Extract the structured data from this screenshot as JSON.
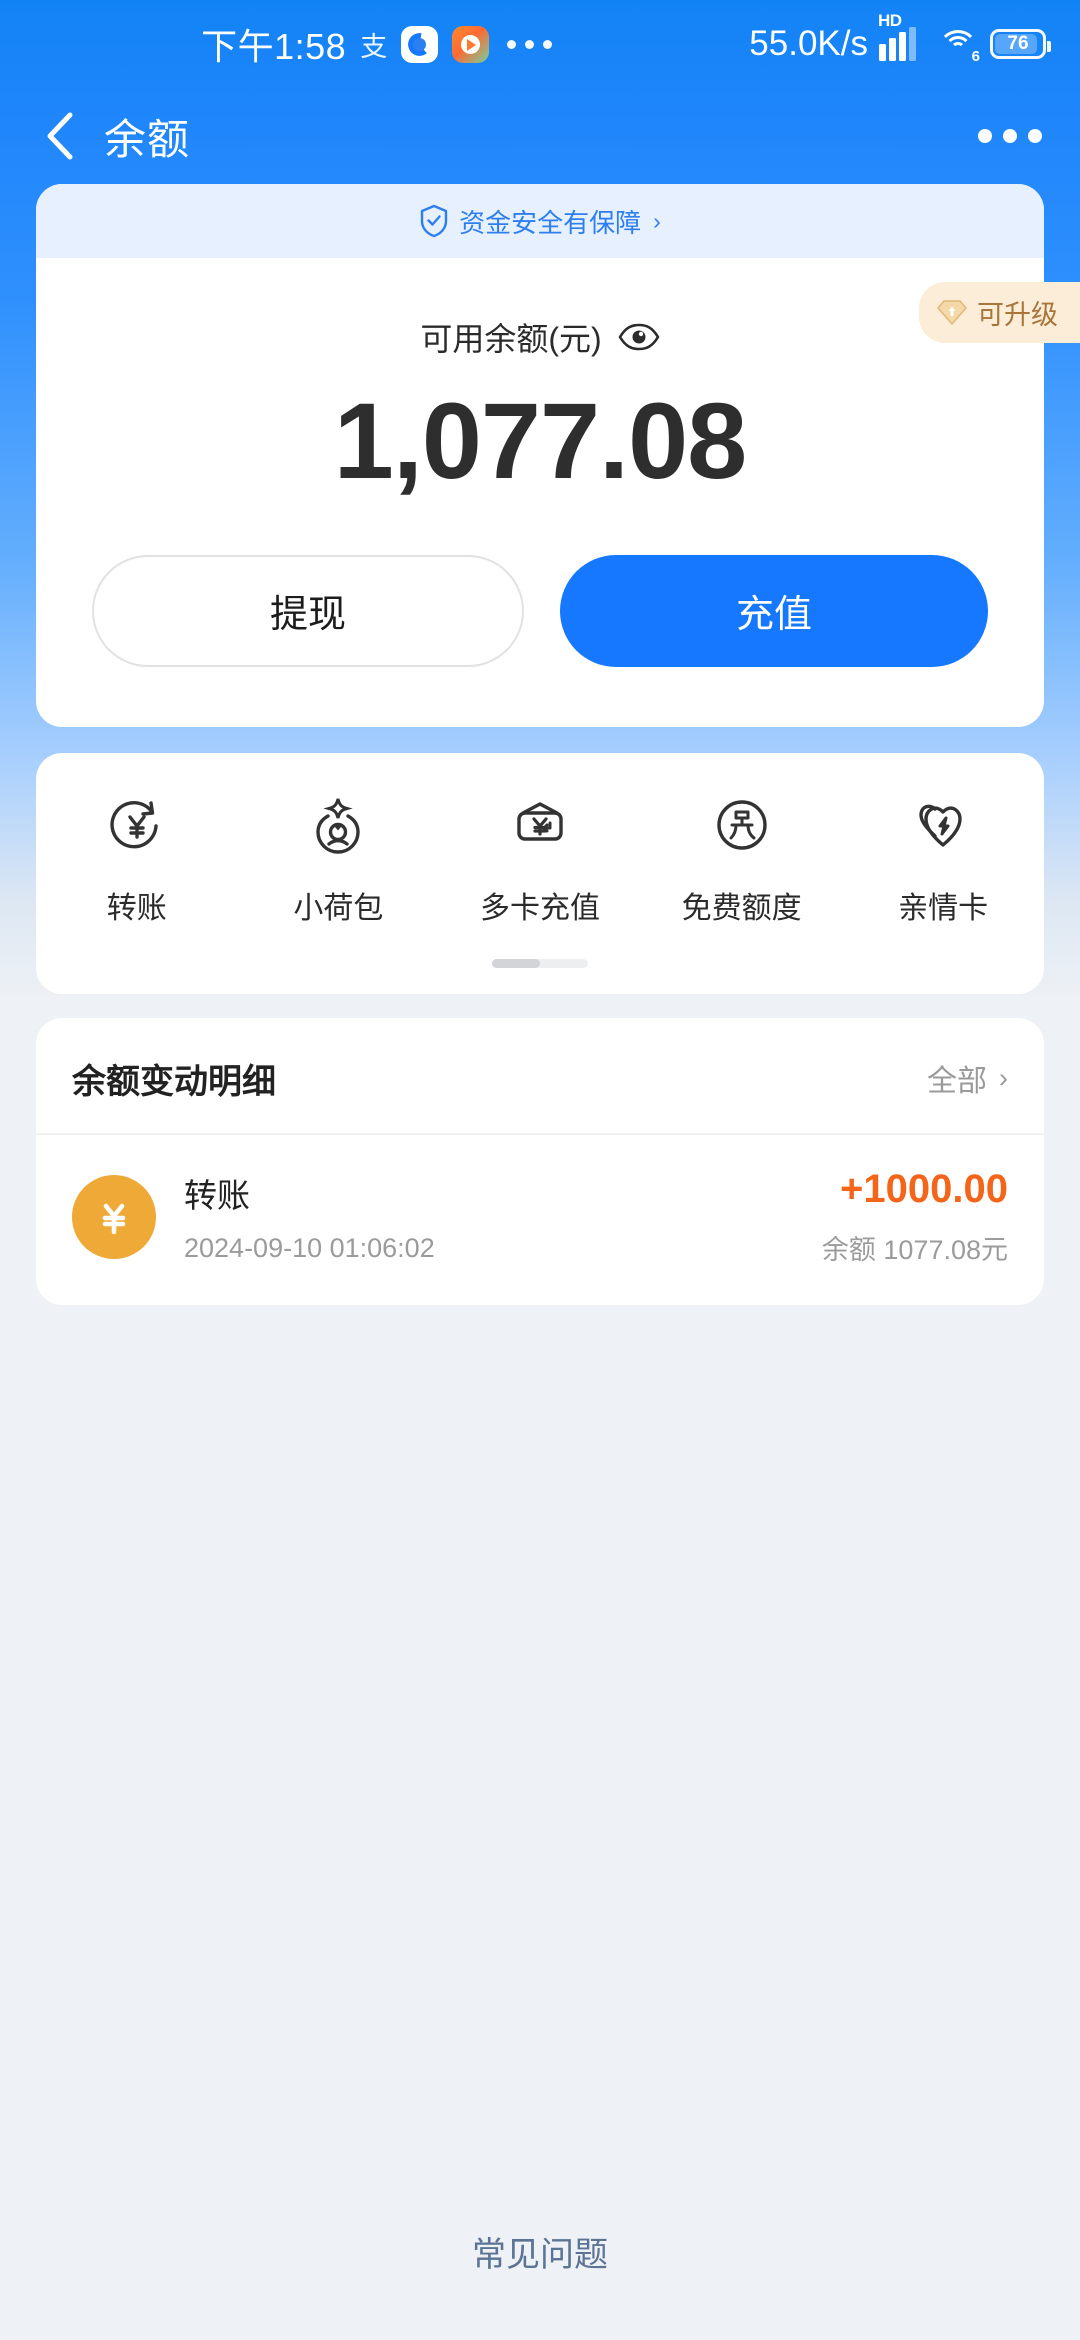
{
  "status_bar": {
    "time": "下午1:58",
    "alipay_glyph": "支",
    "overflow_dots": "•••",
    "network_speed": "55.0K/s",
    "hd_label": "HD",
    "wifi_generation": "6",
    "battery_level": "76",
    "app_icons": [
      "alipay-notification-icon",
      "video-app-notification-icon"
    ]
  },
  "navbar": {
    "back_icon": "chevron-left-icon",
    "title": "余额",
    "more_icon": "more-horizontal-icon"
  },
  "balance_card": {
    "safety_banner": {
      "icon": "shield-check-icon",
      "text": "资金安全有保障",
      "chevron": "›"
    },
    "label": "可用余额(元)",
    "eye_icon": "eye-visible-icon",
    "amount": "1,077.08",
    "upgrade_badge": {
      "icon": "gem-upgrade-icon",
      "text": "可升级"
    },
    "buttons": {
      "withdraw": "提现",
      "recharge": "充值"
    }
  },
  "quick_actions": {
    "items": [
      {
        "icon": "yuan-transfer-icon",
        "label": "转账"
      },
      {
        "icon": "small-pouch-icon",
        "label": "小荷包"
      },
      {
        "icon": "multi-card-recharge-icon",
        "label": "多卡充值"
      },
      {
        "icon": "free-quota-icon",
        "label": "免费额度"
      },
      {
        "icon": "family-card-icon",
        "label": "亲情卡"
      }
    ],
    "scroll_indicator": "page-1-of-2"
  },
  "detail_section": {
    "title": "余额变动明细",
    "all_label": "全部",
    "all_chevron": "›",
    "transactions": [
      {
        "icon": "yuan-circle-icon",
        "title": "转账",
        "time": "2024-09-10 01:06:02",
        "amount": "+1000.00",
        "balance_after": "余额 1077.08元"
      }
    ]
  },
  "footer": {
    "faq_label": "常见问题"
  },
  "colors": {
    "header_blue": "#1f86fb",
    "primary_blue": "#1677ff",
    "safety_bg": "#e6f0fe",
    "safety_text": "#2d7ff0",
    "upgrade_bg": "#fcedd8",
    "upgrade_text": "#a9763a",
    "amount_orange": "#f4651a",
    "txn_icon_orange": "#efa937",
    "page_bg": "#eef1f5",
    "faq_text": "#5b7394"
  }
}
